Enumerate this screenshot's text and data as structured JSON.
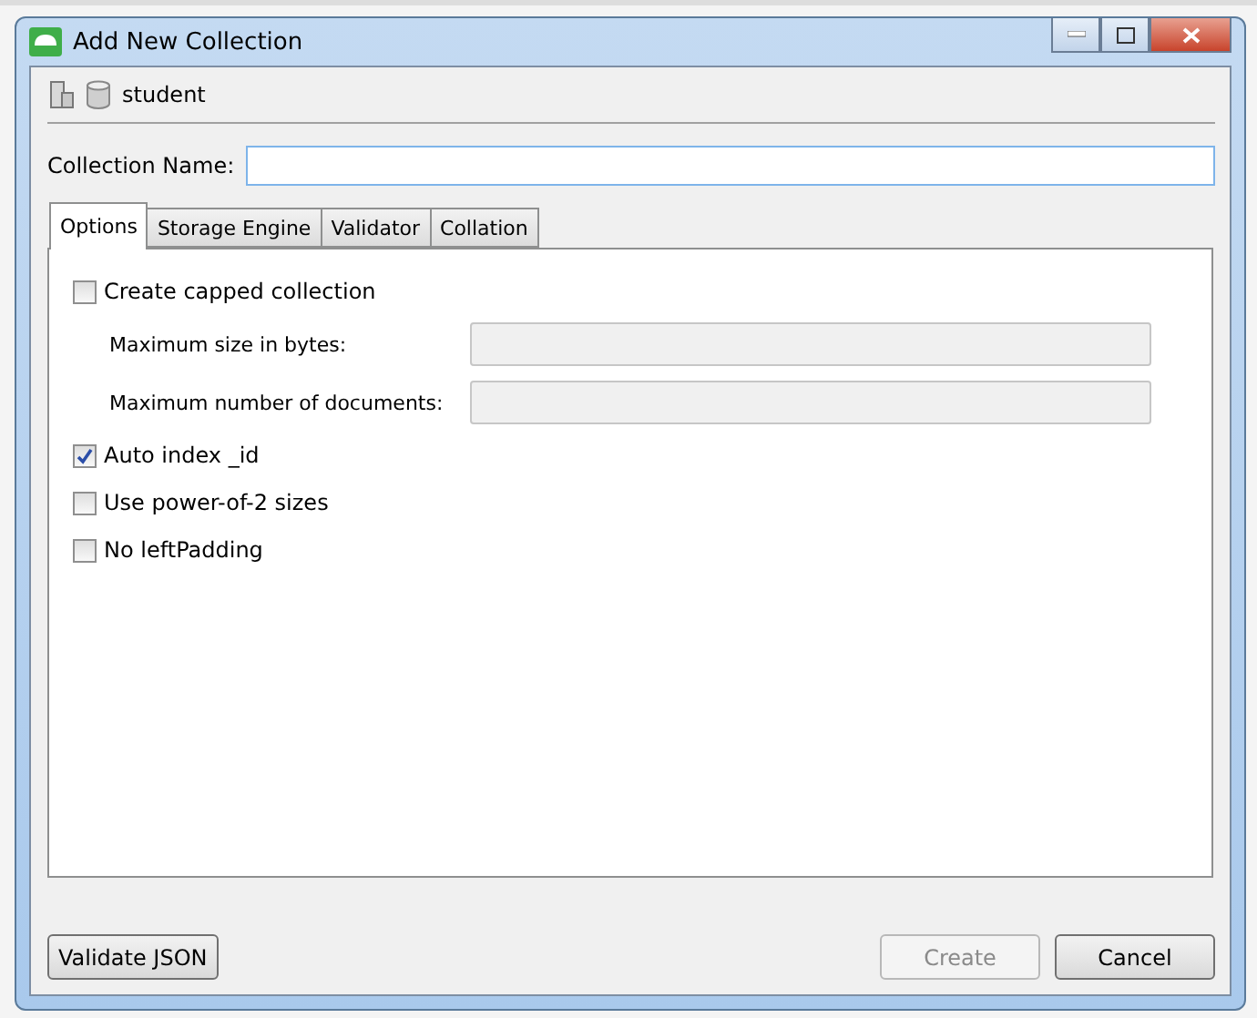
{
  "window": {
    "title": "Add New Collection"
  },
  "database": {
    "name": "student"
  },
  "collection_name": {
    "label": "Collection Name:"
  },
  "tabs": [
    {
      "label": "Options",
      "selected": true
    },
    {
      "label": "Storage Engine",
      "selected": false
    },
    {
      "label": "Validator",
      "selected": false
    },
    {
      "label": "Collation",
      "selected": false
    }
  ],
  "options": [
    {
      "kind": "checkbox",
      "label": "Create capped collection",
      "checked": false
    },
    {
      "kind": "field",
      "label": "Maximum size in bytes:",
      "disabled": true
    },
    {
      "kind": "field",
      "label": "Maximum number of documents:",
      "disabled": true
    },
    {
      "kind": "checkbox",
      "label": "Auto index _id",
      "checked": true
    },
    {
      "kind": "checkbox",
      "label": "Use power-of-2 sizes",
      "checked": false
    },
    {
      "kind": "checkbox",
      "label": "No leftPadding",
      "checked": false
    }
  ],
  "buttons": [
    {
      "label": "Validate JSON",
      "disabled": false
    },
    {
      "label": "Create",
      "disabled": true
    },
    {
      "label": "Cancel",
      "disabled": false
    }
  ]
}
